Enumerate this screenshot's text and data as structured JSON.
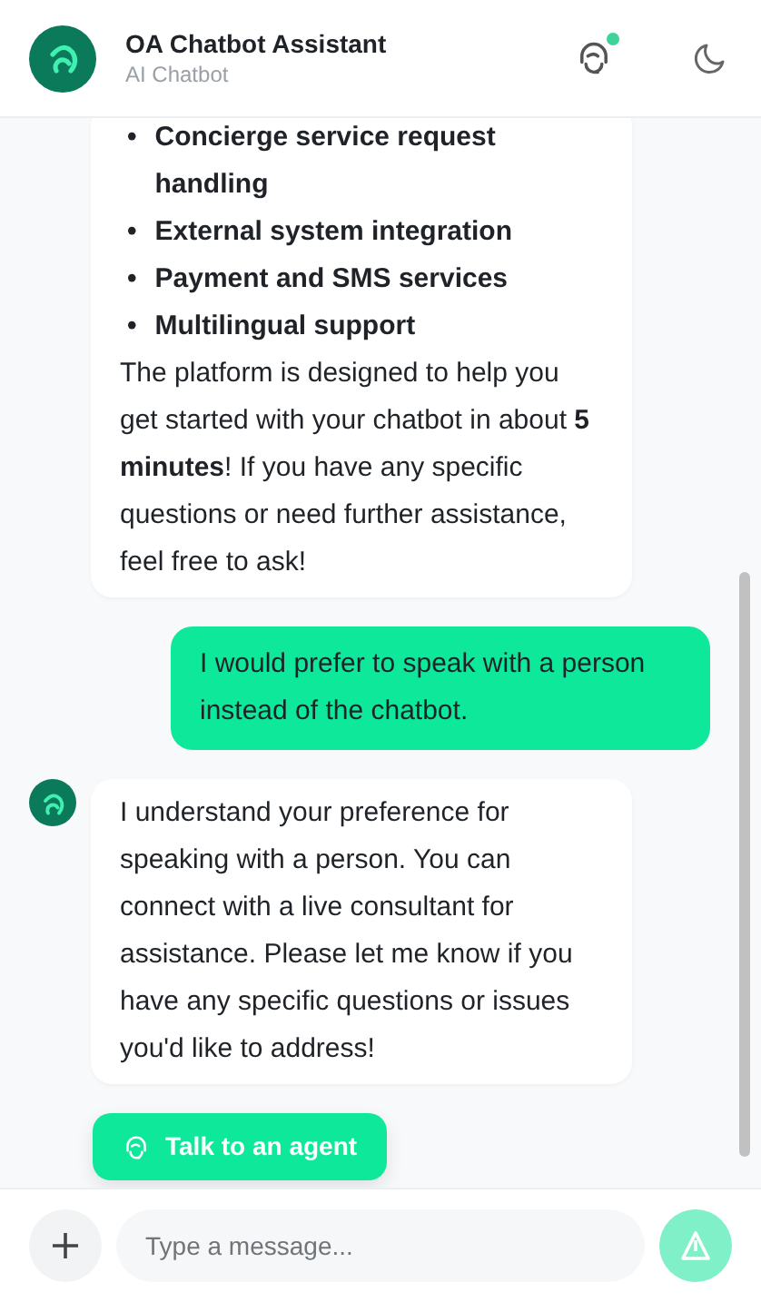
{
  "header": {
    "title": "OA Chatbot Assistant",
    "subtitle": "AI Chatbot",
    "agent_online": true
  },
  "messages": [
    {
      "kind": "bot",
      "avatar": false,
      "list": [
        {
          "marker": "•",
          "text": "Concierge service request handling"
        },
        {
          "marker": "•",
          "text": "External system integration"
        },
        {
          "marker": "•",
          "text": "Payment and SMS services"
        },
        {
          "marker": "•",
          "text": "Multilingual support"
        }
      ],
      "text": "The platform is designed to help you get started with your chatbot in about **5 minutes**! If you have any specific questions or need further assistance, feel free to ask!"
    },
    {
      "kind": "user",
      "text": "I would prefer to speak with a person instead of the chatbot."
    },
    {
      "kind": "bot",
      "avatar": true,
      "text": "I understand your preference for speaking with a person. You can connect with a live consultant for assistance. Please let me know if you have any specific questions or issues you'd like to address!"
    }
  ],
  "action_button": {
    "label": "Talk to an agent"
  },
  "composer": {
    "placeholder": "Type a message...",
    "send_disabled": true
  }
}
